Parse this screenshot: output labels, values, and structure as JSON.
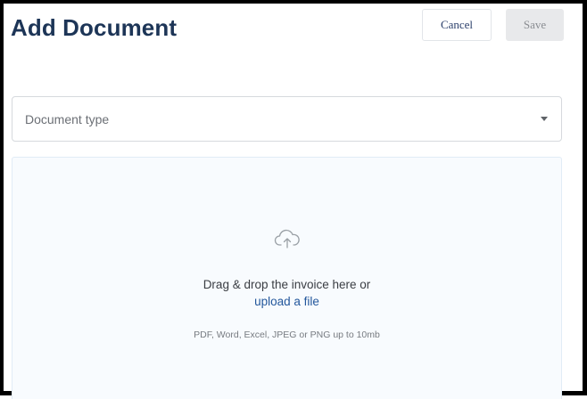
{
  "header": {
    "title": "Add Document",
    "cancel_label": "Cancel",
    "save_label": "Save"
  },
  "form": {
    "document_type": {
      "placeholder": "Document type",
      "icon": "caret-down-icon"
    }
  },
  "dropzone": {
    "icon": "cloud-upload-icon",
    "prompt": "Drag & drop the invoice here or",
    "link_label": "upload a file",
    "hint": "PDF, Word, Excel, JPEG or PNG up to 10mb"
  },
  "colors": {
    "title": "#1d3557",
    "link": "#23579c",
    "dropzone_bg": "#f8fbfe",
    "save_bg": "#e8e9eb"
  }
}
